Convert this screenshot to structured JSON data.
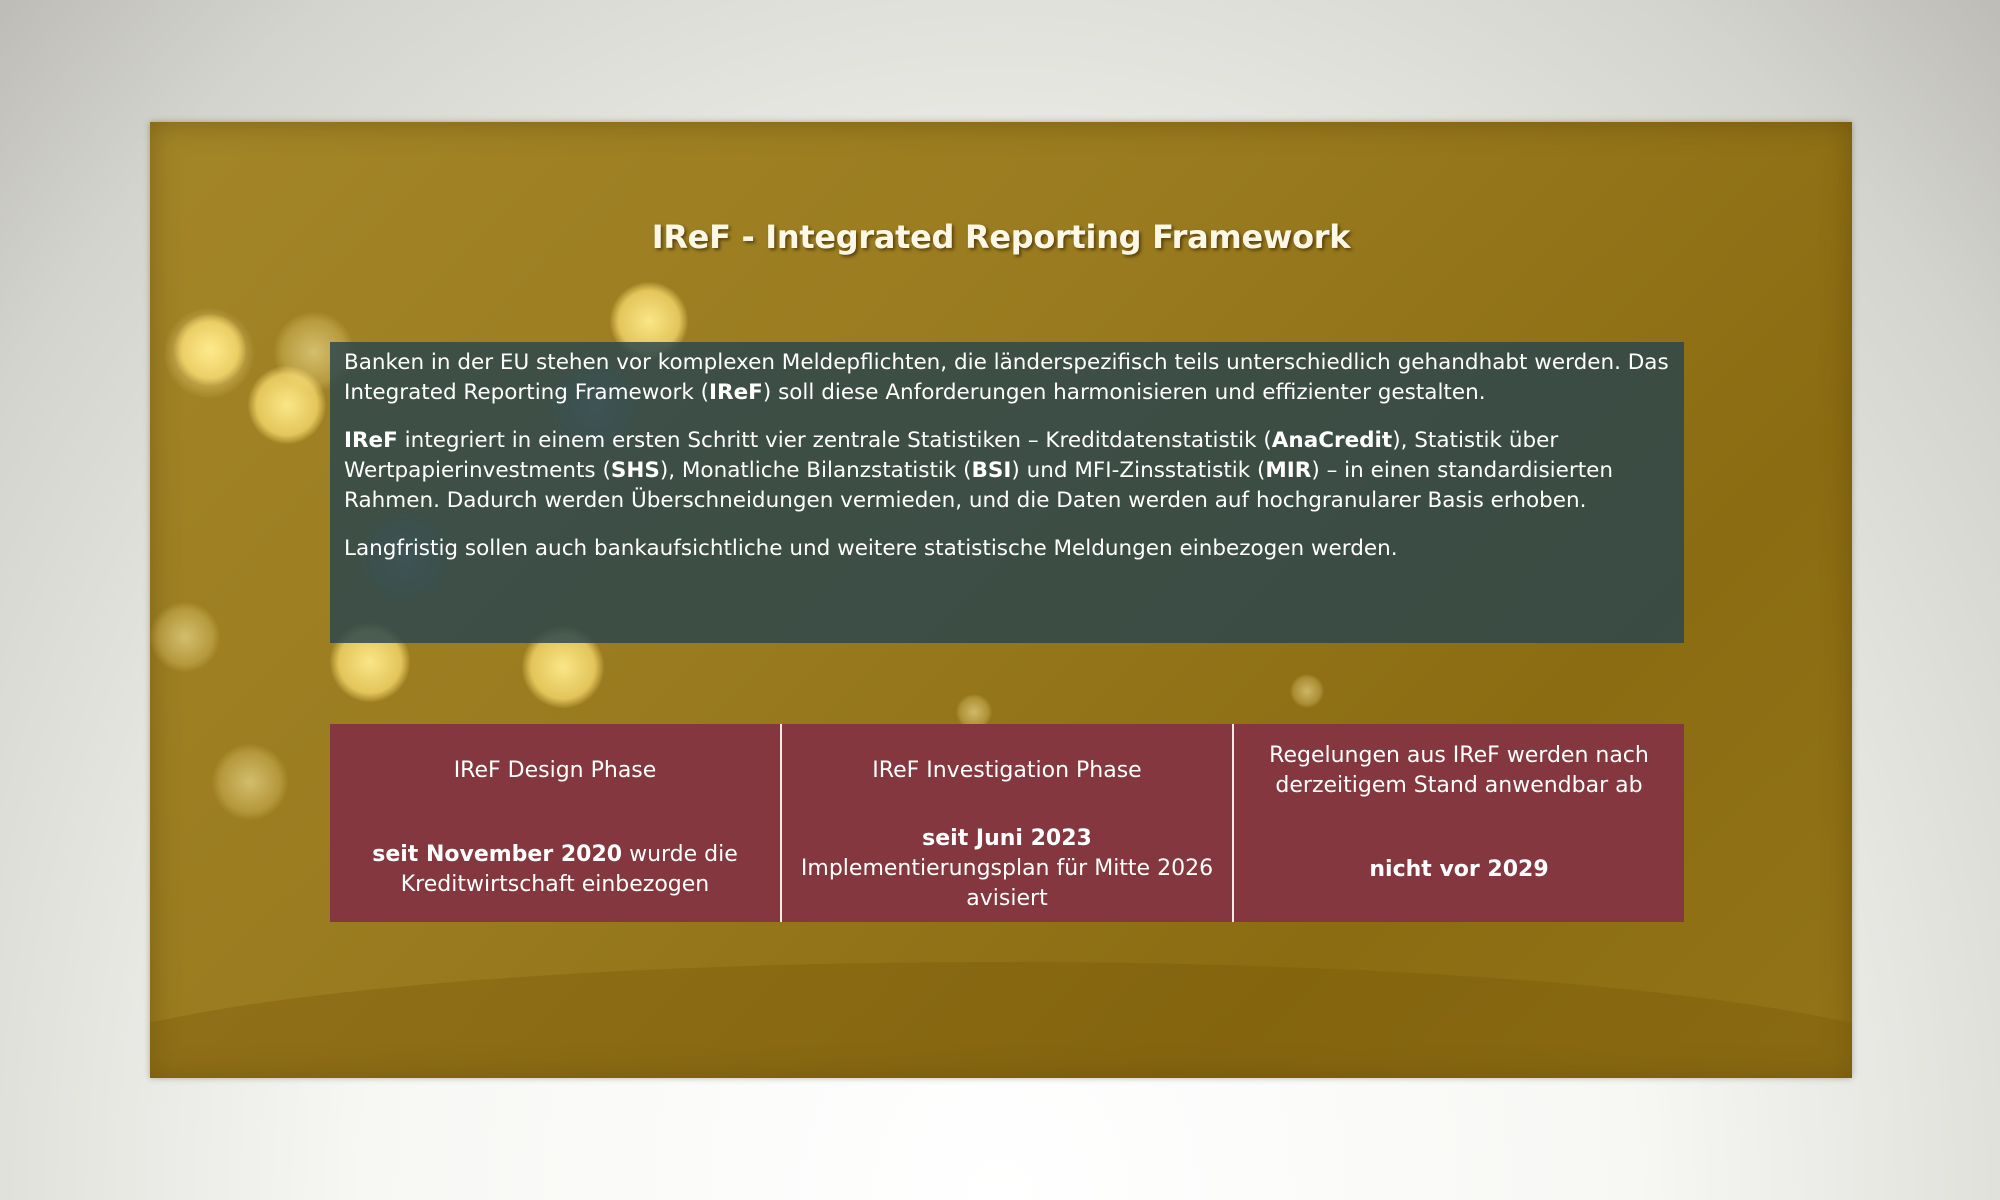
{
  "slide": {
    "title": "IReF - Integrated Reporting Framework",
    "intro": {
      "p1_a": "Banken in der EU stehen vor komplexen Meldepflichten, die länderspezifisch teils unterschiedlich gehandhabt werden. Das Integrated Reporting Framework (",
      "p1_b": "IReF",
      "p1_c": ") soll diese Anforderungen harmonisieren und effizienter gestalten.",
      "p2_a": "IReF",
      "p2_b": " integriert in einem ersten Schritt vier zentrale Statistiken – Kreditdatenstatistik (",
      "p2_c": "AnaCredit",
      "p2_d": "), Statistik über Wertpapierinvestments (",
      "p2_e": "SHS",
      "p2_f": "), Monatliche Bilanzstatistik (",
      "p2_g": "BSI",
      "p2_h": ") und MFI-Zinsstatistik (",
      "p2_i": "MIR",
      "p2_j": ") – in einen standardisierten Rahmen. Dadurch werden Überschneidungen vermieden, und die Daten werden auf hochgranularer Basis erhoben.",
      "p3": "Langfristig sollen auch bankaufsichtliche und weitere statistische Meldungen einbezogen werden."
    },
    "phases": [
      {
        "title": "IReF Design Phase",
        "date": "seit November 2020",
        "body": " wurde die Kreditwirtschaft einbezogen"
      },
      {
        "title": "IReF Investigation Phase",
        "date": "seit Juni 2023",
        "body": "Implementierungsplan für Mitte 2026 avisiert"
      },
      {
        "title": "Regelungen aus IReF werden nach derzeitigem Stand anwendbar ab",
        "date": "nicht vor 2029",
        "body": ""
      }
    ],
    "colors": {
      "background_gold": "#9a7b1f",
      "intro_box": "#28444e",
      "phase_box": "#84373e",
      "text": "#ffffff"
    }
  }
}
